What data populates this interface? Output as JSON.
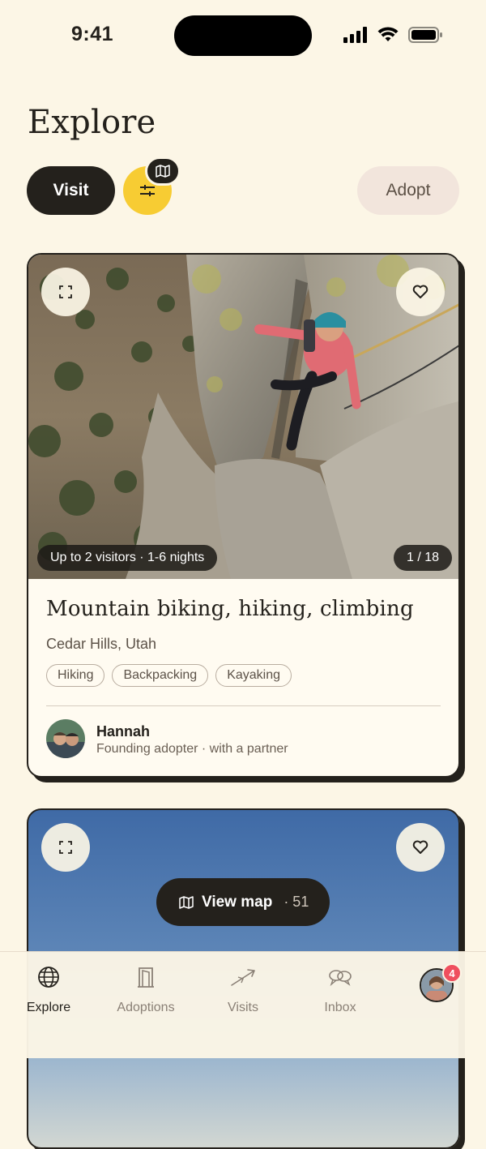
{
  "status_bar": {
    "time": "9:41"
  },
  "page": {
    "title": "Explore"
  },
  "mode_toggle": {
    "visit_label": "Visit",
    "adopt_label": "Adopt"
  },
  "listing": {
    "capacity": "Up to 2 visitors · 1-6 nights",
    "photo_counter": "1 / 18",
    "title": "Mountain biking, hiking, climbing",
    "location": "Cedar Hills, Utah",
    "tags": [
      "Hiking",
      "Backpacking",
      "Kayaking"
    ],
    "host": {
      "name": "Hannah",
      "meta": "Founding adopter · with a partner"
    }
  },
  "view_map": {
    "label": "View map",
    "count": "· 51"
  },
  "nav": {
    "items": [
      {
        "label": "Explore",
        "icon": "globe-icon",
        "active": true
      },
      {
        "label": "Adoptions",
        "icon": "door-icon",
        "active": false
      },
      {
        "label": "Visits",
        "icon": "plane-icon",
        "active": false
      },
      {
        "label": "Inbox",
        "icon": "chat-icon",
        "active": false
      }
    ],
    "profile_badge": "4"
  },
  "colors": {
    "background": "#fcf6e6",
    "ink": "#24211c",
    "accent_yellow": "#f7cc33",
    "badge_red": "#ef4f5e",
    "adopt_bg": "#f2e5dc"
  }
}
